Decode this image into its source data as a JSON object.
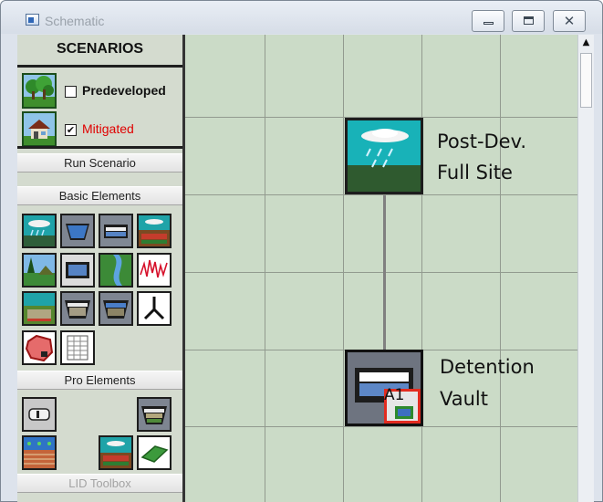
{
  "window": {
    "title": "Schematic",
    "close_glyph": "✕",
    "colors": {
      "canvas": "#cbdbc7",
      "sidebar": "#d4dbcf",
      "mitigated_text": "#e00000"
    }
  },
  "sidebar": {
    "header": "SCENARIOS",
    "scenarios": [
      {
        "label": "Predeveloped",
        "checked": false,
        "icon": "trees-icon",
        "check_mark": ""
      },
      {
        "label": "Mitigated",
        "checked": true,
        "icon": "house-icon",
        "check_mark": "✔"
      }
    ],
    "run_scenario": "Run Scenario",
    "basic_elements_header": "Basic Elements",
    "basic_elements": [
      "rain-cloud-icon",
      "trapezoidal-pond-icon",
      "vault-icon",
      "lateral-basin-icon",
      "landscape-icon",
      "tank-icon",
      "channel-icon",
      "time-series-graph-icon",
      "gravel-trench-icon",
      "filter-strip-icon",
      "infiltration-basin-icon",
      "flow-splitter-icon",
      "irregular-pond-icon",
      "spreadsheet-icon"
    ],
    "pro_elements_header": "Pro Elements",
    "pro_elements": [
      "culvert-icon",
      "sand-filter-icon",
      "bioretention-icon",
      "green-roof-rain-icon",
      "green-roof-icon"
    ],
    "lid_toolbox": "LID Toolbox"
  },
  "canvas": {
    "nodes": [
      {
        "id": "post-dev",
        "icon": "rain-cloud-icon",
        "label_line1": "Post-Dev.",
        "label_line2": "Full Site"
      },
      {
        "id": "vault",
        "icon": "detention-vault-icon",
        "label_line1": "Detention",
        "label_line2": "Vault",
        "badge_text": "A1"
      }
    ]
  },
  "scrollbar": {
    "up_arrow": "▲"
  }
}
